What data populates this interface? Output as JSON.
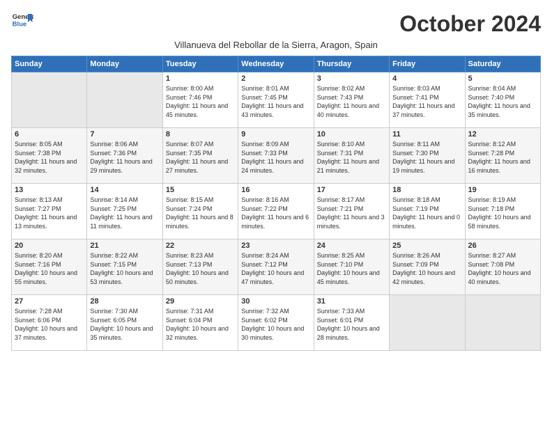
{
  "header": {
    "logo_line1": "General",
    "logo_line2": "Blue",
    "month_title": "October 2024",
    "subtitle": "Villanueva del Rebollar de la Sierra, Aragon, Spain"
  },
  "days_of_week": [
    "Sunday",
    "Monday",
    "Tuesday",
    "Wednesday",
    "Thursday",
    "Friday",
    "Saturday"
  ],
  "weeks": [
    [
      {
        "day": "",
        "empty": true
      },
      {
        "day": "",
        "empty": true
      },
      {
        "day": "1",
        "sunrise": "8:00 AM",
        "sunset": "7:46 PM",
        "daylight": "11 hours and 45 minutes."
      },
      {
        "day": "2",
        "sunrise": "8:01 AM",
        "sunset": "7:45 PM",
        "daylight": "11 hours and 43 minutes."
      },
      {
        "day": "3",
        "sunrise": "8:02 AM",
        "sunset": "7:43 PM",
        "daylight": "11 hours and 40 minutes."
      },
      {
        "day": "4",
        "sunrise": "8:03 AM",
        "sunset": "7:41 PM",
        "daylight": "11 hours and 37 minutes."
      },
      {
        "day": "5",
        "sunrise": "8:04 AM",
        "sunset": "7:40 PM",
        "daylight": "11 hours and 35 minutes."
      }
    ],
    [
      {
        "day": "6",
        "sunrise": "8:05 AM",
        "sunset": "7:38 PM",
        "daylight": "11 hours and 32 minutes."
      },
      {
        "day": "7",
        "sunrise": "8:06 AM",
        "sunset": "7:36 PM",
        "daylight": "11 hours and 29 minutes."
      },
      {
        "day": "8",
        "sunrise": "8:07 AM",
        "sunset": "7:35 PM",
        "daylight": "11 hours and 27 minutes."
      },
      {
        "day": "9",
        "sunrise": "8:09 AM",
        "sunset": "7:33 PM",
        "daylight": "11 hours and 24 minutes."
      },
      {
        "day": "10",
        "sunrise": "8:10 AM",
        "sunset": "7:31 PM",
        "daylight": "11 hours and 21 minutes."
      },
      {
        "day": "11",
        "sunrise": "8:11 AM",
        "sunset": "7:30 PM",
        "daylight": "11 hours and 19 minutes."
      },
      {
        "day": "12",
        "sunrise": "8:12 AM",
        "sunset": "7:28 PM",
        "daylight": "11 hours and 16 minutes."
      }
    ],
    [
      {
        "day": "13",
        "sunrise": "8:13 AM",
        "sunset": "7:27 PM",
        "daylight": "11 hours and 13 minutes."
      },
      {
        "day": "14",
        "sunrise": "8:14 AM",
        "sunset": "7:25 PM",
        "daylight": "11 hours and 11 minutes."
      },
      {
        "day": "15",
        "sunrise": "8:15 AM",
        "sunset": "7:24 PM",
        "daylight": "11 hours and 8 minutes."
      },
      {
        "day": "16",
        "sunrise": "8:16 AM",
        "sunset": "7:22 PM",
        "daylight": "11 hours and 6 minutes."
      },
      {
        "day": "17",
        "sunrise": "8:17 AM",
        "sunset": "7:21 PM",
        "daylight": "11 hours and 3 minutes."
      },
      {
        "day": "18",
        "sunrise": "8:18 AM",
        "sunset": "7:19 PM",
        "daylight": "11 hours and 0 minutes."
      },
      {
        "day": "19",
        "sunrise": "8:19 AM",
        "sunset": "7:18 PM",
        "daylight": "10 hours and 58 minutes."
      }
    ],
    [
      {
        "day": "20",
        "sunrise": "8:20 AM",
        "sunset": "7:16 PM",
        "daylight": "10 hours and 55 minutes."
      },
      {
        "day": "21",
        "sunrise": "8:22 AM",
        "sunset": "7:15 PM",
        "daylight": "10 hours and 53 minutes."
      },
      {
        "day": "22",
        "sunrise": "8:23 AM",
        "sunset": "7:13 PM",
        "daylight": "10 hours and 50 minutes."
      },
      {
        "day": "23",
        "sunrise": "8:24 AM",
        "sunset": "7:12 PM",
        "daylight": "10 hours and 47 minutes."
      },
      {
        "day": "24",
        "sunrise": "8:25 AM",
        "sunset": "7:10 PM",
        "daylight": "10 hours and 45 minutes."
      },
      {
        "day": "25",
        "sunrise": "8:26 AM",
        "sunset": "7:09 PM",
        "daylight": "10 hours and 42 minutes."
      },
      {
        "day": "26",
        "sunrise": "8:27 AM",
        "sunset": "7:08 PM",
        "daylight": "10 hours and 40 minutes."
      }
    ],
    [
      {
        "day": "27",
        "sunrise": "7:28 AM",
        "sunset": "6:06 PM",
        "daylight": "10 hours and 37 minutes."
      },
      {
        "day": "28",
        "sunrise": "7:30 AM",
        "sunset": "6:05 PM",
        "daylight": "10 hours and 35 minutes."
      },
      {
        "day": "29",
        "sunrise": "7:31 AM",
        "sunset": "6:04 PM",
        "daylight": "10 hours and 32 minutes."
      },
      {
        "day": "30",
        "sunrise": "7:32 AM",
        "sunset": "6:02 PM",
        "daylight": "10 hours and 30 minutes."
      },
      {
        "day": "31",
        "sunrise": "7:33 AM",
        "sunset": "6:01 PM",
        "daylight": "10 hours and 28 minutes."
      },
      {
        "day": "",
        "empty": true
      },
      {
        "day": "",
        "empty": true
      }
    ]
  ]
}
